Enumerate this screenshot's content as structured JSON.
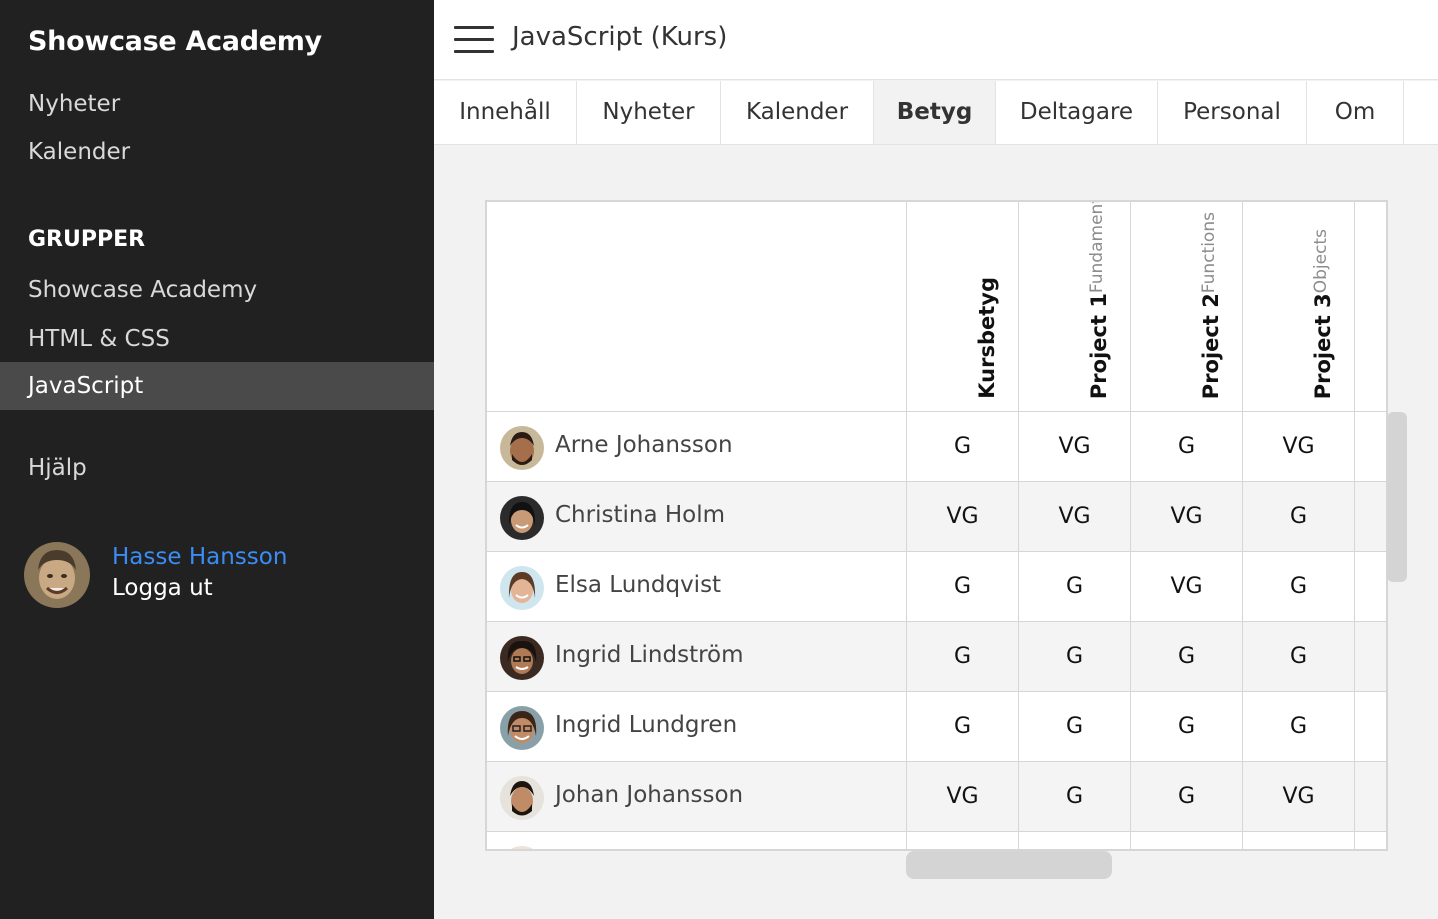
{
  "sidebar": {
    "brand": "Showcase Academy",
    "links": [
      {
        "label": "Nyheter"
      },
      {
        "label": "Kalender"
      }
    ],
    "groups_heading": "GRUPPER",
    "groups": [
      {
        "label": "Showcase Academy"
      },
      {
        "label": "HTML & CSS"
      },
      {
        "label": "JavaScript"
      }
    ],
    "help": "Hjälp",
    "user": {
      "name": "Hasse Hansson",
      "logout": "Logga ut"
    }
  },
  "header": {
    "title": "JavaScript (Kurs)"
  },
  "tabs": [
    {
      "label": "Innehåll"
    },
    {
      "label": "Nyheter"
    },
    {
      "label": "Kalender"
    },
    {
      "label": "Betyg"
    },
    {
      "label": "Deltagare"
    },
    {
      "label": "Personal"
    },
    {
      "label": "Om"
    }
  ],
  "grades": {
    "columns": [
      {
        "sub": "",
        "main": "Kursbetyg"
      },
      {
        "sub": "Fundamentals",
        "main": "Project 1"
      },
      {
        "sub": "Functions",
        "main": "Project 2"
      },
      {
        "sub": "Objects",
        "main": "Project 3"
      }
    ],
    "rows": [
      {
        "name": "Arne Johansson",
        "grades": [
          "G",
          "VG",
          "G",
          "VG"
        ]
      },
      {
        "name": "Christina Holm",
        "grades": [
          "VG",
          "VG",
          "VG",
          "G"
        ]
      },
      {
        "name": "Elsa Lundqvist",
        "grades": [
          "G",
          "G",
          "VG",
          "G"
        ]
      },
      {
        "name": "Ingrid Lindström",
        "grades": [
          "G",
          "G",
          "G",
          "G"
        ]
      },
      {
        "name": "Ingrid Lundgren",
        "grades": [
          "G",
          "G",
          "G",
          "G"
        ]
      },
      {
        "name": "Johan Johansson",
        "grades": [
          "VG",
          "G",
          "G",
          "VG"
        ]
      }
    ]
  }
}
